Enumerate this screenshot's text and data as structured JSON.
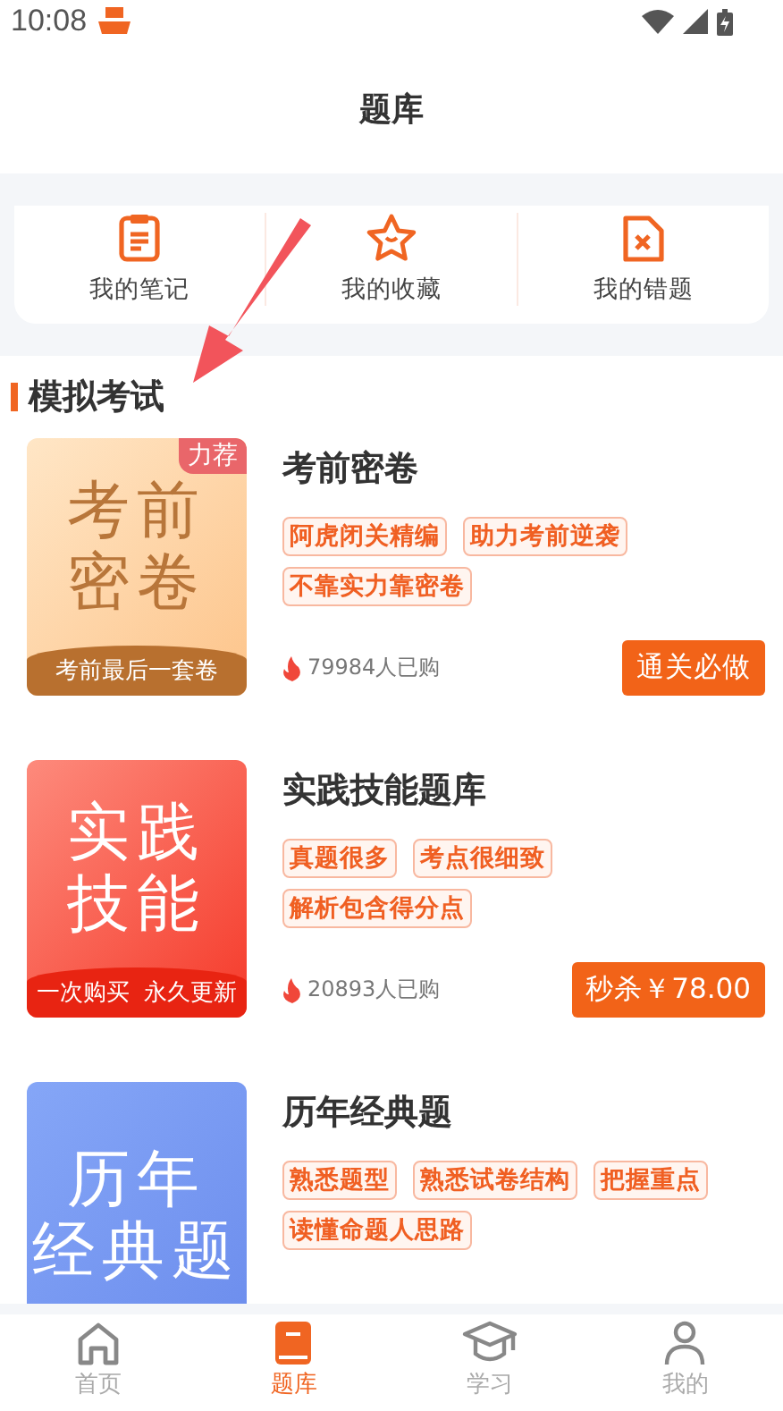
{
  "status_bar": {
    "time": "10:08"
  },
  "header": {
    "title": "题库"
  },
  "shortcuts": [
    {
      "kind": "note",
      "label": "我的笔记"
    },
    {
      "kind": "star",
      "label": "我的收藏"
    },
    {
      "kind": "wrong",
      "label": "我的错题"
    }
  ],
  "section": {
    "title": "模拟考试"
  },
  "products": [
    {
      "kind": "gold",
      "cover_lines": [
        "考前",
        "密卷"
      ],
      "cover_badge": "力荐",
      "cover_ribbon": "考前最后一套卷",
      "title": "考前密卷",
      "tags": [
        "阿虎闭关精编",
        "助力考前逆袭",
        "不靠实力靠密卷"
      ],
      "buyers": "79984人已购",
      "action": "通关必做"
    },
    {
      "kind": "red",
      "cover_lines": [
        "实践",
        "技能"
      ],
      "cover_ribbon": "一次购买  永久更新",
      "title": "实践技能题库",
      "tags": [
        "真题很多",
        "考点很细致",
        "解析包含得分点"
      ],
      "buyers": "20893人已购",
      "action": "秒杀￥78.00"
    },
    {
      "kind": "blue",
      "cover_lines": [
        "历年",
        "经典题"
      ],
      "title": "历年经典题",
      "tags": [
        "熟悉题型",
        "熟悉试卷结构",
        "把握重点",
        "读懂命题人思路"
      ]
    }
  ],
  "tab_bar": [
    {
      "kind": "home",
      "label": "首页",
      "selected": false
    },
    {
      "kind": "book",
      "label": "题库",
      "selected": true
    },
    {
      "kind": "cap",
      "label": "学习",
      "selected": false
    },
    {
      "kind": "person",
      "label": "我的",
      "selected": false
    }
  ]
}
